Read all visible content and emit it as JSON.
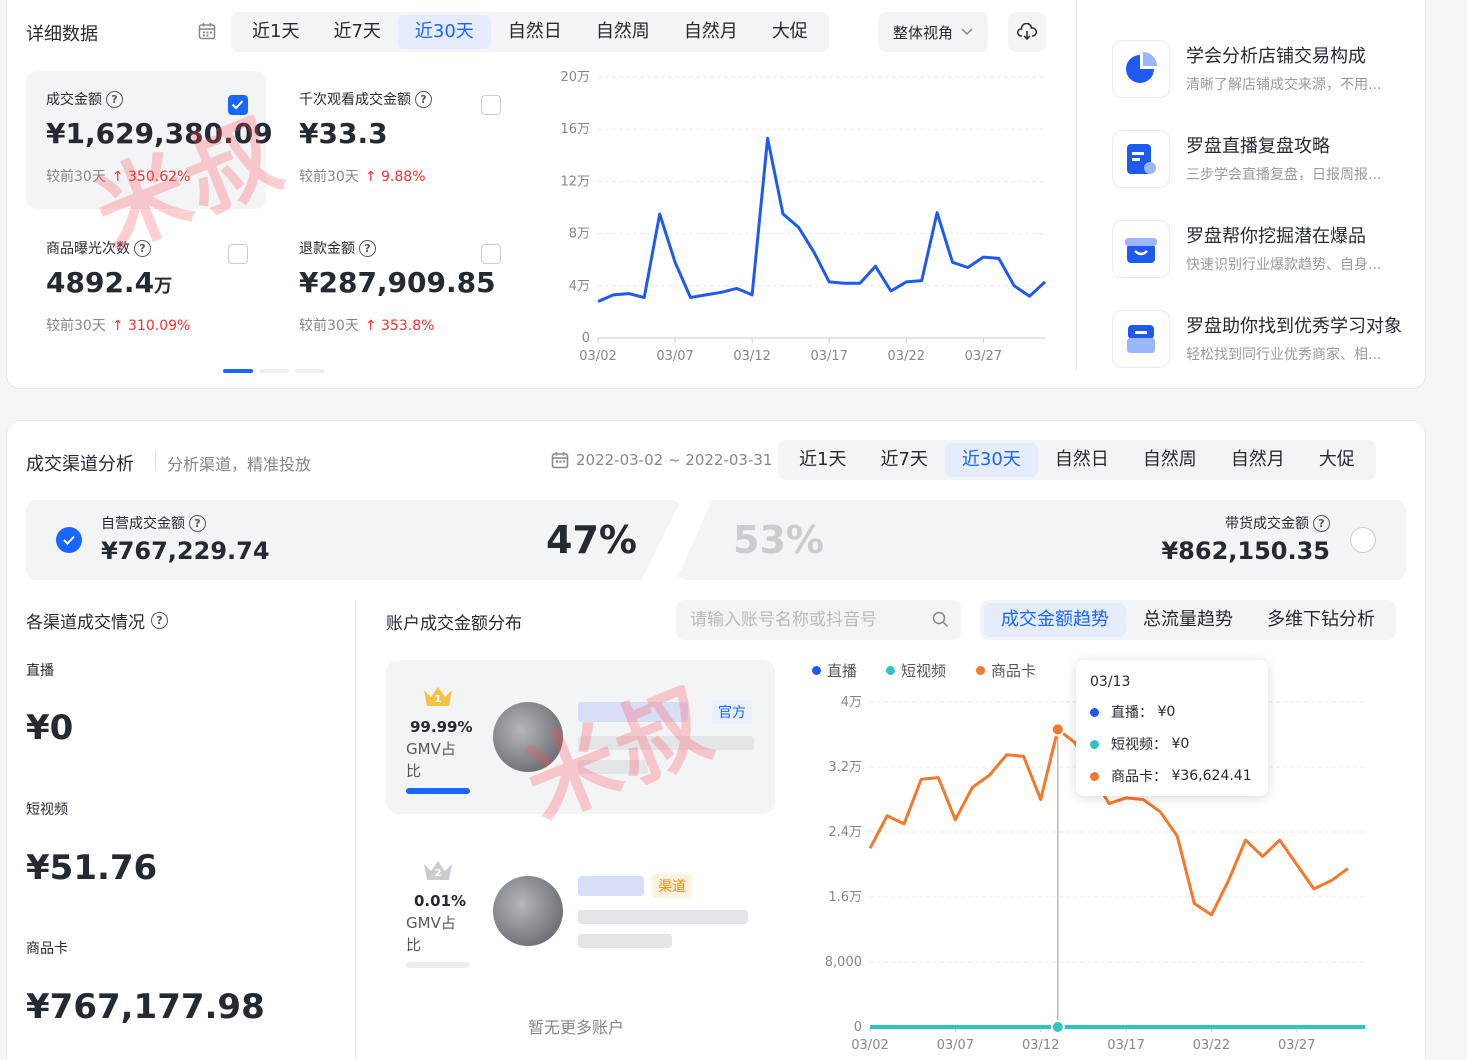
{
  "detail": {
    "title": "详细数据",
    "tabs": [
      "近1天",
      "近7天",
      "近30天",
      "自然日",
      "自然周",
      "自然月",
      "大促"
    ],
    "active_tab": 2,
    "view_select": "整体视角",
    "metrics": [
      {
        "label": "成交金额",
        "value": "¥1,629,380.09",
        "compare": "较前30天",
        "change": "350.62%",
        "checked": true
      },
      {
        "label": "千次观看成交金额",
        "value": "¥33.3",
        "compare": "较前30天",
        "change": "9.88%",
        "checked": false
      },
      {
        "label": "商品曝光次数",
        "value": "4892.4",
        "value_unit": "万",
        "compare": "较前30天",
        "change": "310.09%",
        "checked": false
      },
      {
        "label": "退款金额",
        "value": "¥287,909.85",
        "compare": "较前30天",
        "change": "353.8%",
        "checked": false
      }
    ],
    "question_mark": "?"
  },
  "chart_data": [
    {
      "type": "line",
      "x": [
        "03/02",
        "03/03",
        "03/04",
        "03/05",
        "03/06",
        "03/07",
        "03/08",
        "03/09",
        "03/10",
        "03/11",
        "03/12",
        "03/13",
        "03/14",
        "03/15",
        "03/16",
        "03/17",
        "03/18",
        "03/19",
        "03/20",
        "03/21",
        "03/22",
        "03/23",
        "03/24",
        "03/25",
        "03/26",
        "03/27",
        "03/28",
        "03/29",
        "03/30",
        "03/31"
      ],
      "series": [
        {
          "values": [
            28000,
            33000,
            34000,
            31000,
            95000,
            58000,
            31000,
            33000,
            35000,
            38000,
            33000,
            153000,
            95000,
            85000,
            66000,
            43000,
            42000,
            42000,
            55000,
            36000,
            43000,
            44000,
            96000,
            58000,
            54000,
            62000,
            61000,
            40000,
            32000,
            43000
          ]
        }
      ],
      "ylim": [
        0,
        200000
      ],
      "yticks": [
        "0",
        "4万",
        "8万",
        "12万",
        "16万",
        "20万"
      ],
      "xticks": [
        "03/02",
        "03/07",
        "03/12",
        "03/17",
        "03/22",
        "03/27"
      ],
      "color": "#1f5af0",
      "grid": true
    },
    {
      "type": "line",
      "x": [
        "03/02",
        "03/03",
        "03/04",
        "03/05",
        "03/06",
        "03/07",
        "03/08",
        "03/09",
        "03/10",
        "03/11",
        "03/12",
        "03/13",
        "03/14",
        "03/15",
        "03/16",
        "03/17",
        "03/18",
        "03/19",
        "03/20",
        "03/21",
        "03/22",
        "03/23",
        "03/24",
        "03/25",
        "03/26",
        "03/27",
        "03/28",
        "03/29",
        "03/30",
        "03/31"
      ],
      "series": [
        {
          "name": "直播",
          "color": "#1f5af0",
          "values": [
            0,
            0,
            0,
            0,
            0,
            0,
            0,
            0,
            0,
            0,
            0,
            0,
            0,
            0,
            0,
            0,
            0,
            0,
            0,
            0,
            0,
            0,
            0,
            0,
            0,
            0,
            0,
            0,
            0,
            0
          ]
        },
        {
          "name": "短视频",
          "color": "#2fc4c4",
          "values": [
            0,
            0,
            0,
            0,
            0,
            0,
            0,
            0,
            0,
            0,
            0,
            0,
            0,
            0,
            0,
            0,
            0,
            0,
            0,
            0,
            0,
            0,
            0,
            0,
            0,
            0,
            0,
            0,
            0,
            0
          ]
        },
        {
          "name": "商品卡",
          "color": "#f5782a",
          "values": [
            22000,
            26000,
            25000,
            30500,
            30700,
            25500,
            29500,
            31000,
            33500,
            33300,
            28000,
            36624,
            35000,
            31000,
            27500,
            28200,
            28000,
            26500,
            23500,
            15200,
            13800,
            18000,
            23000,
            21000,
            23000,
            20000,
            17000,
            18000,
            19500
          ]
        }
      ],
      "ylim": [
        0,
        40000
      ],
      "yticks": [
        "0",
        "8,000",
        "1.6万",
        "2.4万",
        "3.2万",
        "4万"
      ],
      "xticks": [
        "03/02",
        "03/07",
        "03/12",
        "03/17",
        "03/22",
        "03/27"
      ],
      "grid": true,
      "legend": "top-left"
    }
  ],
  "side": {
    "items": [
      {
        "title": "学会分析店铺交易构成",
        "desc": "清晰了解店铺成交来源，不用..."
      },
      {
        "title": "罗盘直播复盘攻略",
        "desc": "三步学会直播复盘，日报周报..."
      },
      {
        "title": "罗盘帮你挖掘潜在爆品",
        "desc": "快速识别行业爆款趋势、自身..."
      },
      {
        "title": "罗盘助你找到优秀学习对象",
        "desc": "轻松找到同行业优秀商家、相..."
      }
    ]
  },
  "channel": {
    "title": "成交渠道分析",
    "subtitle": "分析渠道，精准投放",
    "date_range": "2022-03-02 ~ 2022-03-31",
    "tabs": [
      "近1天",
      "近7天",
      "近30天",
      "自然日",
      "自然周",
      "自然月",
      "大促"
    ],
    "active_tab": 2,
    "self_label": "自营成交金额",
    "self_value": "¥767,229.74",
    "self_pct": "47%",
    "other_pct": "53%",
    "other_label": "带货成交金额",
    "other_value": "¥862,150.35",
    "breakdown_title": "各渠道成交情况",
    "channels": [
      {
        "label": "直播",
        "value": "¥0"
      },
      {
        "label": "短视频",
        "value": "¥51.76"
      },
      {
        "label": "商品卡",
        "value": "¥767,177.98"
      }
    ],
    "account_title": "账户成交金额分布",
    "search_placeholder": "请输入账号名称或抖音号",
    "view_tabs": [
      "成交金额趋势",
      "总流量趋势",
      "多维下钻分析"
    ],
    "active_view": 0,
    "accounts": [
      {
        "rank": "1",
        "pct": "99.99%",
        "gmv_label": "GMV占比",
        "tag": "官方",
        "share": 0.9999
      },
      {
        "rank": "2",
        "pct": "0.01%",
        "gmv_label": "GMV占比",
        "tag": "渠道",
        "share": 0.0001
      }
    ],
    "no_more": "暂无更多账户",
    "tooltip": {
      "date": "03/13",
      "rows": [
        {
          "name": "直播",
          "value": "¥0",
          "color": "#1f5af0"
        },
        {
          "name": "短视频",
          "value": "¥0",
          "color": "#2fc4c4"
        },
        {
          "name": "商品卡",
          "value": "¥36,624.41",
          "color": "#f5782a"
        }
      ]
    }
  },
  "watermark": "米叔"
}
